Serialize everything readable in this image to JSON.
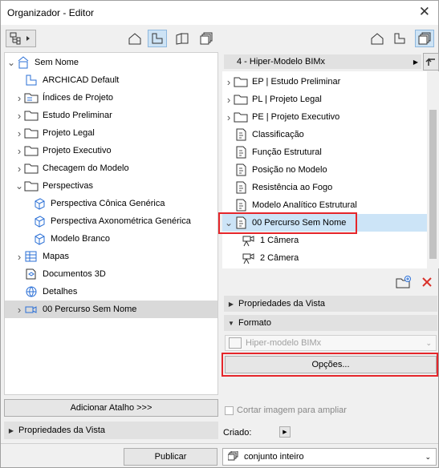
{
  "window": {
    "title": "Organizador - Editor"
  },
  "left_tree": [
    {
      "label": "Sem Nome",
      "chev": "v",
      "indent": 0,
      "icon": "project-icon"
    },
    {
      "label": "ARCHICAD Default",
      "chev": "",
      "indent": 1,
      "icon": "default-view-icon"
    },
    {
      "label": "Índices de Projeto",
      "chev": ">",
      "indent": 1,
      "icon": "index-folder-icon"
    },
    {
      "label": "Estudo Preliminar",
      "chev": ">",
      "indent": 1,
      "icon": "folder-icon"
    },
    {
      "label": "Projeto Legal",
      "chev": ">",
      "indent": 1,
      "icon": "folder-icon"
    },
    {
      "label": "Projeto Executivo",
      "chev": ">",
      "indent": 1,
      "icon": "folder-icon"
    },
    {
      "label": "Checagem do Modelo",
      "chev": ">",
      "indent": 1,
      "icon": "folder-icon"
    },
    {
      "label": "Perspectivas",
      "chev": "v",
      "indent": 1,
      "icon": "folder-icon"
    },
    {
      "label": "Perspectiva Cônica Genérica",
      "chev": "",
      "indent": 2,
      "icon": "cube-icon"
    },
    {
      "label": "Perspectiva Axonométrica Genérica",
      "chev": "",
      "indent": 2,
      "icon": "cube-icon"
    },
    {
      "label": "Modelo Branco",
      "chev": "",
      "indent": 2,
      "icon": "cube-icon"
    },
    {
      "label": "Mapas",
      "chev": ">",
      "indent": 1,
      "icon": "schedule-icon"
    },
    {
      "label": "Documentos 3D",
      "chev": "",
      "indent": 1,
      "icon": "document-3d-icon"
    },
    {
      "label": "Detalhes",
      "chev": "",
      "indent": 1,
      "icon": "globe-icon"
    },
    {
      "label": "00 Percurso Sem Nome",
      "chev": ">",
      "indent": 1,
      "icon": "camera-path-icon",
      "selected": true
    }
  ],
  "right_header": {
    "dropdown": "4 - Hiper-Modelo BIMx"
  },
  "right_tree": [
    {
      "label": "EP | Estudo Preliminar",
      "chev": ">",
      "indent": 0,
      "icon": "folder-icon"
    },
    {
      "label": "PL | Projeto Legal",
      "chev": ">",
      "indent": 0,
      "icon": "folder-icon"
    },
    {
      "label": "PE | Projeto Executivo",
      "chev": ">",
      "indent": 0,
      "icon": "folder-icon"
    },
    {
      "label": "Classificação",
      "chev": "",
      "indent": 0,
      "icon": "view-icon"
    },
    {
      "label": "Função Estrutural",
      "chev": "",
      "indent": 0,
      "icon": "view-icon"
    },
    {
      "label": "Posição no Modelo",
      "chev": "",
      "indent": 0,
      "icon": "view-icon"
    },
    {
      "label": "Resistência ao Fogo",
      "chev": "",
      "indent": 0,
      "icon": "view-icon"
    },
    {
      "label": "Modelo Analítico Estrutural",
      "chev": "",
      "indent": 0,
      "icon": "view-icon"
    },
    {
      "label": "00 Percurso Sem Nome",
      "chev": "v",
      "indent": 0,
      "icon": "view-icon",
      "selected": true
    },
    {
      "label": "1 Câmera",
      "chev": "",
      "indent": 1,
      "icon": "camera-icon"
    },
    {
      "label": "2 Câmera",
      "chev": "",
      "indent": 1,
      "icon": "camera-icon"
    }
  ],
  "left_bottom": {
    "add_shortcut": "Adicionar Atalho >>>",
    "view_props": "Propriedades da Vista"
  },
  "right_sections": {
    "view_props": "Propriedades da Vista",
    "format": "Formato",
    "format_value": "Hiper-modelo BIMx",
    "options": "Opções...",
    "crop_label": "Cortar imagem para ampliar",
    "created_label": "Criado:"
  },
  "footer": {
    "publish": "Publicar",
    "scope": "conjunto inteiro"
  },
  "colors": {
    "highlight": "#e5262b",
    "selected_row": "#d9d9d9",
    "active_tab": "#cde3f5"
  }
}
